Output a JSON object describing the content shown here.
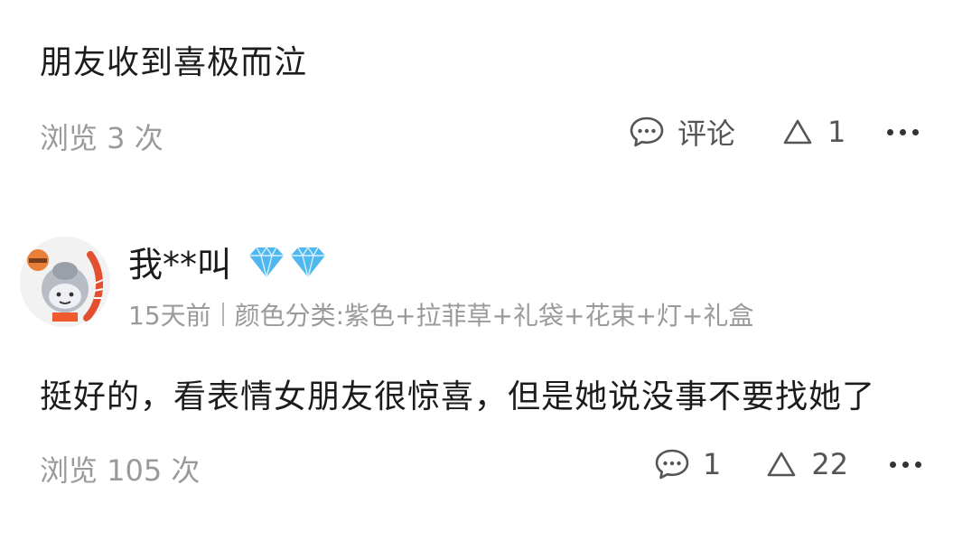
{
  "review1": {
    "text": "朋友收到喜极而泣",
    "views": "浏览 3 次",
    "comment_label": "评论",
    "like_count": "1"
  },
  "review2": {
    "username": "我**叫",
    "date": "15天前",
    "variant": "颜色分类:紫色+拉菲草+礼袋+花束+灯+礼盒",
    "text": "挺好的，看表情女朋友很惊喜，但是她说没事不要找她了",
    "views": "浏览 105 次",
    "comment_count": "1",
    "like_count": "22"
  },
  "colors": {
    "diamond": "#4fb8ef",
    "muted": "#9a9a9a"
  },
  "icons": [
    "comment-icon",
    "like-triangle-icon",
    "more-icon",
    "diamond-badge-icon"
  ]
}
